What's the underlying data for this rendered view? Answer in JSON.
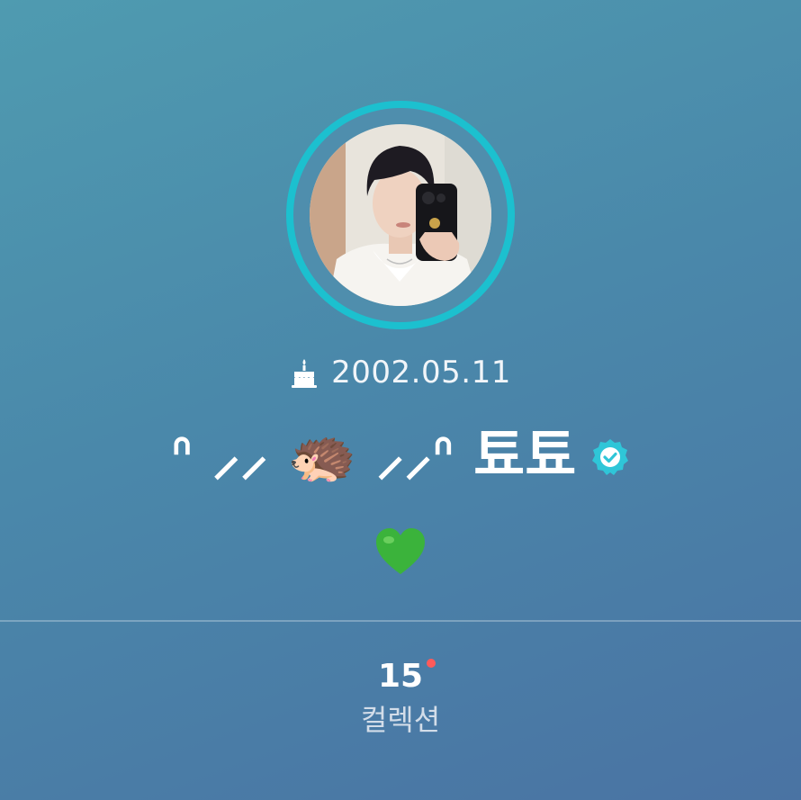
{
  "profile": {
    "birthday": "2002.05.11",
    "display_name": "ᐢ ⸝⸝ 🦔 ⸝⸝ᐢ 툐툐",
    "verified": true,
    "bio": "💚"
  },
  "stats": {
    "collection_count": "15",
    "collection_label": "컬렉션",
    "has_new": true
  },
  "icons": {
    "birthday": "cake-icon",
    "verified": "verified-badge-icon"
  },
  "colors": {
    "accent_ring": "#1cc0cf",
    "verified_badge": "#2fc6d8",
    "new_dot": "#ff5a5a",
    "heart": "#3bb33b"
  }
}
